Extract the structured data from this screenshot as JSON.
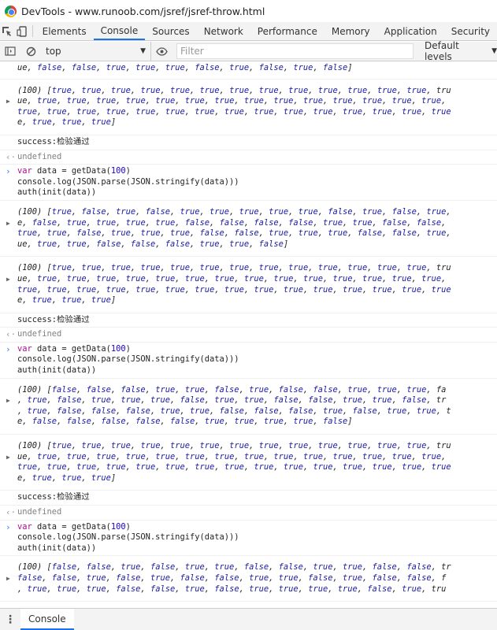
{
  "window": {
    "title": "DevTools - www.runoob.com/jsref/jsref-throw.html",
    "icon": "chrome-icon"
  },
  "toolbar": {
    "tabs": [
      "Elements",
      "Console",
      "Sources",
      "Network",
      "Performance",
      "Memory",
      "Application",
      "Security"
    ],
    "active_tab": "Console",
    "accent": "#1a73e8"
  },
  "filterbar": {
    "context": "top",
    "filter_placeholder": "Filter",
    "levels": "Default levels"
  },
  "console": {
    "entries": [
      {
        "type": "array-tail",
        "lines": [
          "ue, false, false, true, true, true, false, true, false, true, false]"
        ]
      },
      {
        "type": "array",
        "lines": [
          "(100) [true, true, true, true, true, true, true, true, true, true, true, true, true, tru",
          "ue, true, true, true, true, true, true, true, true, true, true, true, true, true, true,",
          "true, true, true, true, true, true, true, true, true, true, true, true, true, true, true",
          "e, true, true, true]"
        ]
      },
      {
        "type": "log",
        "text": "success:检验通过"
      },
      {
        "type": "result",
        "text": "undefined"
      },
      {
        "type": "input",
        "lines": [
          "var data = getData(100)",
          "console.log(JSON.parse(JSON.stringify(data)))",
          "auth(init(data))"
        ]
      },
      {
        "type": "array",
        "lines": [
          "(100) [true, false, true, false, true, true, true, true, true, false, true, false, true,",
          "e, false, true, true, true, true, false, false, false, false, true, true, false, false,",
          "true, true, false, true, true, true, false, false, true, true, true, false, false, true,",
          "ue, true, true, false, false, false, true, true, false]"
        ]
      },
      {
        "type": "array",
        "lines": [
          "(100) [true, true, true, true, true, true, true, true, true, true, true, true, true, tru",
          "ue, true, true, true, true, true, true, true, true, true, true, true, true, true, true,",
          "true, true, true, true, true, true, true, true, true, true, true, true, true, true, true",
          "e, true, true, true]"
        ]
      },
      {
        "type": "log",
        "text": "success:检验通过"
      },
      {
        "type": "result",
        "text": "undefined"
      },
      {
        "type": "input",
        "lines": [
          "var data = getData(100)",
          "console.log(JSON.parse(JSON.stringify(data)))",
          "auth(init(data))"
        ]
      },
      {
        "type": "array",
        "lines": [
          "(100) [false, false, false, true, true, false, true, false, false, true, true, true, fa",
          ", true, false, true, true, true, false, true, true, false, false, true, true, false, tr",
          ", true, false, false, false, true, true, false, false, false, true, false, true, true, t",
          "e, false, false, false, false, false, true, true, true, true, false]"
        ]
      },
      {
        "type": "array",
        "lines": [
          "(100) [true, true, true, true, true, true, true, true, true, true, true, true, true, tru",
          "ue, true, true, true, true, true, true, true, true, true, true, true, true, true, true,",
          "true, true, true, true, true, true, true, true, true, true, true, true, true, true, true",
          "e, true, true, true]"
        ]
      },
      {
        "type": "log",
        "text": "success:检验通过"
      },
      {
        "type": "result",
        "text": "undefined"
      },
      {
        "type": "input",
        "lines": [
          "var data = getData(100)",
          "console.log(JSON.parse(JSON.stringify(data)))",
          "auth(init(data))"
        ]
      },
      {
        "type": "array",
        "lines": [
          "(100) [false, false, true, false, true, true, false, false, true, true, false, false, tr",
          "false, false, true, false, true, false, false, true, true, false, true, false, false, f",
          ", true, true, true, false, false, true, false, true, true, true, true, false, true, tru"
        ]
      }
    ]
  },
  "drawer": {
    "tab": "Console"
  },
  "colors": {
    "keyword": "#aa0d91",
    "number": "#1c00cf",
    "boolean": "#1a1aa6",
    "undefined": "#808080",
    "prompt": "#367cf1"
  }
}
